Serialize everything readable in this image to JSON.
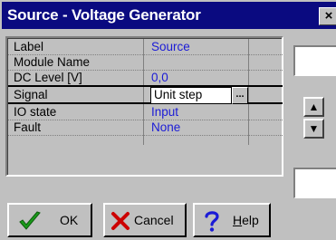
{
  "window": {
    "title": "Source - Voltage Generator",
    "close_glyph": "×"
  },
  "properties": [
    {
      "label": "Label",
      "value": "Source"
    },
    {
      "label": "Module Name",
      "value": ""
    },
    {
      "label": "DC Level [V]",
      "value": "0,0"
    },
    {
      "label": "Signal",
      "value": "Unit step",
      "selected": true,
      "ellipsis": "..."
    },
    {
      "label": "IO state",
      "value": "Input"
    },
    {
      "label": "Fault",
      "value": "None"
    }
  ],
  "buttons": {
    "ok": {
      "label": "OK",
      "icon": "check-icon"
    },
    "cancel": {
      "label": "Cancel",
      "icon": "cross-icon"
    },
    "help": {
      "label_underlined": "H",
      "label_rest": "elp",
      "icon": "question-icon"
    }
  },
  "spinner": {
    "up_glyph": "▲",
    "down_glyph": "▼"
  },
  "colors": {
    "titlebar": "#0a0a80",
    "face": "#c0c0c0",
    "value_text": "#1b1bd6",
    "check": "#1a9a1a",
    "cross": "#cc0000",
    "question": "#1b1bd6"
  }
}
